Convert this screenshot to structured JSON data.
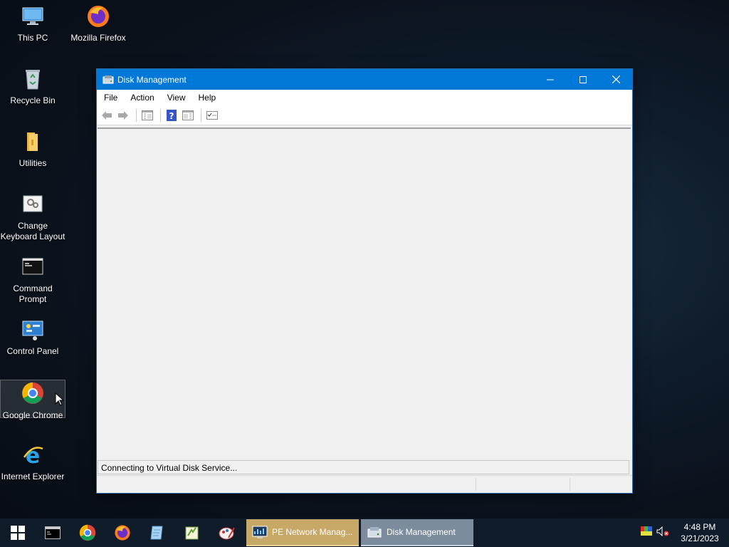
{
  "desktop": {
    "icons": [
      {
        "label": "This PC"
      },
      {
        "label": "Mozilla Firefox"
      },
      {
        "label": "Recycle Bin"
      },
      {
        "label": "Utilities"
      },
      {
        "label": "Change Keyboard Layout"
      },
      {
        "label": "Command Prompt"
      },
      {
        "label": "Control Panel"
      },
      {
        "label": "Google Chrome"
      },
      {
        "label": "Internet Explorer"
      }
    ]
  },
  "window": {
    "title": "Disk Management",
    "menu": [
      "File",
      "Action",
      "View",
      "Help"
    ],
    "toolbar_icons": [
      "back-arrow-icon",
      "forward-arrow-icon",
      "show-hide-console-tree-icon",
      "help-icon",
      "show-hide-action-pane-icon",
      "properties-icon"
    ],
    "status_text": "Connecting to Virtual Disk Service..."
  },
  "taskbar": {
    "pinned": [
      "start-icon",
      "command-prompt-icon",
      "chrome-icon",
      "firefox-icon",
      "notepad-icon",
      "notepad-plus-icon",
      "paint-icon"
    ],
    "tasks": [
      {
        "label": "PE Network Manag...",
        "color": "#c8a866"
      },
      {
        "label": "Disk Management",
        "color": "#7d8c9c"
      }
    ],
    "clock": {
      "time": "4:48 PM",
      "date": "3/21/2023"
    }
  },
  "colors": {
    "titlebar": "#0078d7",
    "taskbar": "#101c29"
  }
}
